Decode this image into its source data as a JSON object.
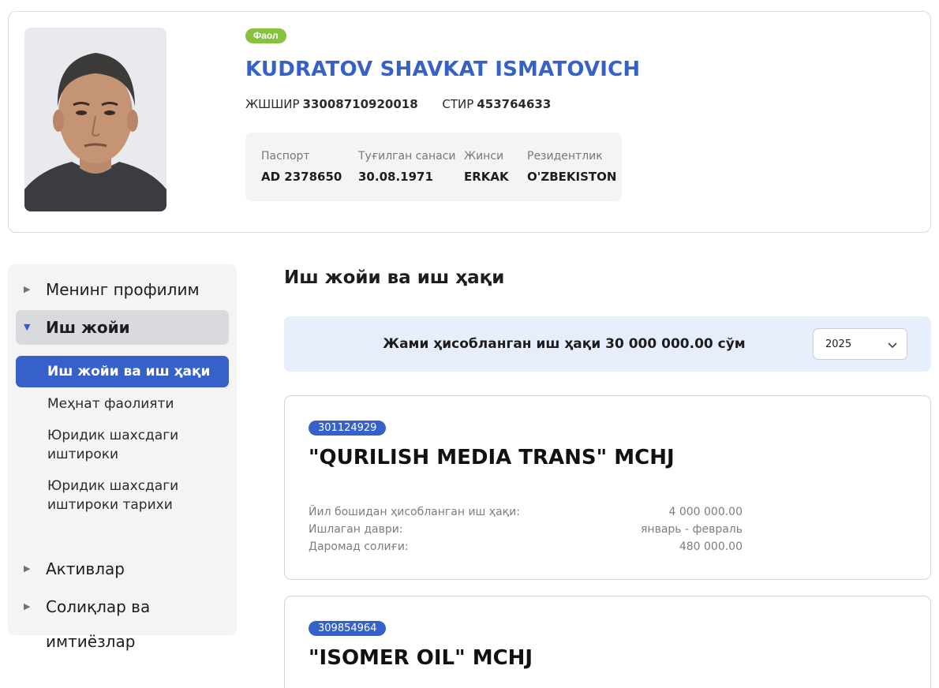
{
  "profile": {
    "status": "Фаол",
    "name": "KUDRATOV SHAVKAT ISMATOVICH",
    "jshshir_label": "ЖШШИР",
    "jshshir": "33008710920018",
    "stir_label": "СТИР",
    "stir": "453764633",
    "info": [
      {
        "key": "Паспорт",
        "value": "AD 2378650"
      },
      {
        "key": "Туғилган санаси",
        "value": "30.08.1971"
      },
      {
        "key": "Жинси",
        "value": "ERKAK"
      },
      {
        "key": "Резидентлик",
        "value": "O'ZBEKISTON"
      }
    ]
  },
  "sidebar": {
    "items": [
      {
        "label": "Менинг профилим"
      },
      {
        "label": "Иш жойи"
      },
      {
        "label": "Активлар"
      },
      {
        "label": "Солиқлар ва имтиёзлар"
      }
    ],
    "sub_items": [
      {
        "label": "Иш жойи ва иш ҳақи"
      },
      {
        "label": "Меҳнат фаолияти"
      },
      {
        "label": "Юридик шахсдаги иштироки"
      },
      {
        "label": "Юридик шахсдаги иштироки тарихи"
      }
    ]
  },
  "main": {
    "title": "Иш жойи ва иш ҳақи",
    "total_text": "Жами ҳисобланган иш ҳақи 30 000 000.00 сўм",
    "year": "2025",
    "companies": [
      {
        "inn": "301124929",
        "name": "\"QURILISH MEDIA TRANS\" MCHJ",
        "rows": [
          {
            "label": "Йил бошидан ҳисобланган иш ҳақи:",
            "value": "4 000 000.00"
          },
          {
            "label": "Ишлаган даври:",
            "value": "январь - февраль"
          },
          {
            "label": "Даромад солиғи:",
            "value": "480 000.00"
          }
        ]
      },
      {
        "inn": "309854964",
        "name": "\"ISOMER OIL\" MCHJ"
      }
    ]
  }
}
